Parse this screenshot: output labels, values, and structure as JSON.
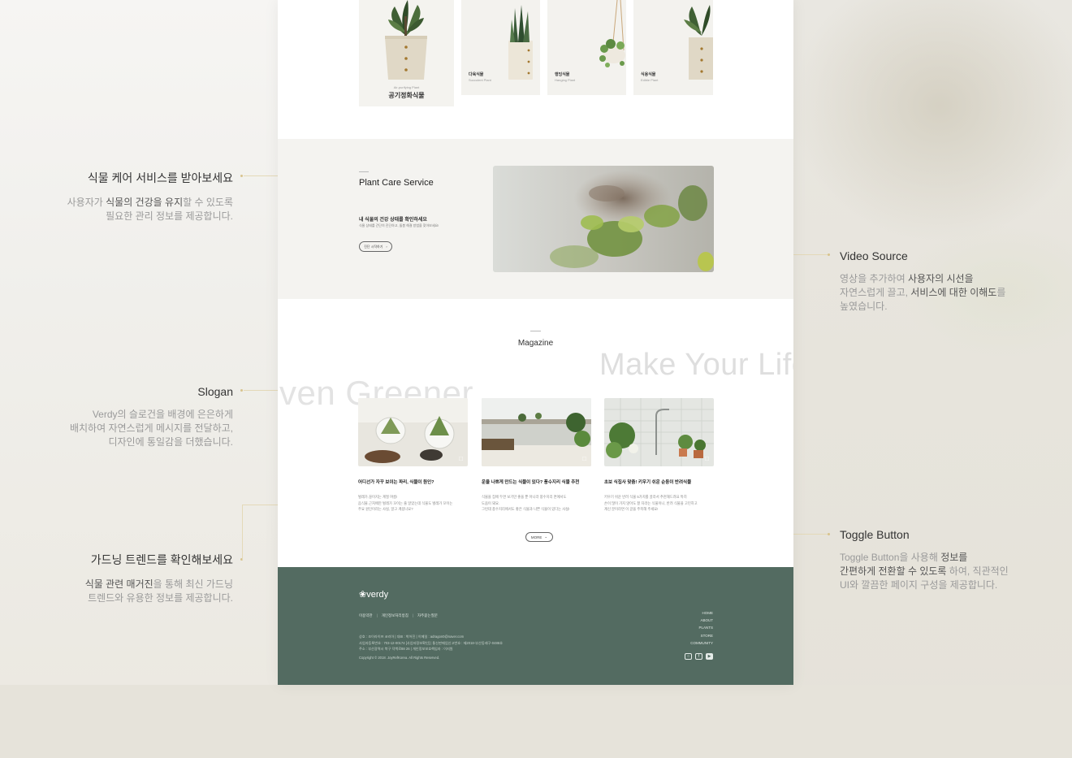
{
  "plants": {
    "big": {
      "sub": "Air-purifying Plant",
      "title": "공기정화식물"
    },
    "cards": [
      {
        "title": "다육식물",
        "sub": "Succulent Plant"
      },
      {
        "title": "행잉식물",
        "sub": "Hanging Plant"
      },
      {
        "title": "식용식물",
        "sub": "Edible Plant"
      }
    ]
  },
  "care": {
    "title": "Plant Care Service",
    "caption": "내 식물의 건강 상태를 확인하세요",
    "desc": "식물 상태를 간단히 진단하고, 돌봄 해결 방법을 찾아보세요!",
    "button": "진단 시작하기"
  },
  "magazine": {
    "title": "Magazine",
    "slogan_a": "ven Greener",
    "slogan_b": "Make Your Life",
    "items": [
      {
        "title": "어디선가 자꾸 보이는 파리, 식물이 원인?",
        "line1": "벌레가 끊이지는 계절 여름!",
        "line2": "음식물 근처에만 벌레가 꼬이는 줄 알았는데 식물도 벌레가 꼬이는",
        "line3": "주요 원인이라는 사실, 알고 계셨나요?"
      },
      {
        "title": "운을 나쁘게 만드는 식물이 있다? 풍수지리 식물 추천",
        "line1": "식물을 집에 두면 보기만 좋을 뿐 아니라 풍수지리 면에서도",
        "line2": "도움이 돼요.",
        "line3": "그런데 풍수지리에서도 좋은 식물과 나쁜 식물이 있다는 사실!"
      },
      {
        "title": "초보 식집사 맞춤! 키우기 쉬운 순둥이 반려식물",
        "line1": "키우기 쉬운 반려 식물 5가지를 골라서 추천해드려요 특히",
        "line2": "손이 많이 가지 않아도 잘 자라는 식물이니, 반려 식물을 고민하고",
        "line3": "계신 분이라면 이 글을 주목해 주세요!"
      }
    ],
    "more": "MORE"
  },
  "footer": {
    "logo": "verdy",
    "links": [
      "이용약관",
      "개인정보처리방침",
      "자주묻는질문"
    ],
    "info1": "상호 : 조이라이프 코리아 | 대표 : 박어진 | 이메일 : adragon0@naver.com",
    "info2": "사업자등록번호 : 703-12-00174 [사업자정보확인] | 통신판매업신고번호 : 제2018-부산동래구-0486호",
    "info3": "주소 : 부산광역시 북구 덕백로88 26 | 개인정보보호책임자 : 이지원",
    "copyright": "Copyright © 2018. JoyRefKorea. All Rights Reserved.",
    "nav": [
      "HOME",
      "ABOUT",
      "PLANTS",
      "STORE",
      "COMMUNITY"
    ]
  },
  "annotations": {
    "care": {
      "title": "식물 케어 서비스를 받아보세요",
      "d1a": "사용자가 ",
      "d1b": "식물의 건강을 유지",
      "d1c": "할 수 있도록",
      "d2": "필요한 관리 정보를 제공합니다."
    },
    "slogan": {
      "title": "Slogan",
      "d1": "Verdy의 슬로건을 배경에 은은하게",
      "d2": "배치하여 자연스럽게 메시지를 전달하고,",
      "d3": "디자인에 통일감을 더했습니다."
    },
    "trend": {
      "title": "가드닝 트렌드를 확인해보세요",
      "d1a": "식물 관련 매거진",
      "d1b": "을 통해 최신 가드닝",
      "d2": "트렌드와 유용한 정보를 제공합니다."
    },
    "video": {
      "title": "Video Source",
      "d1a": "영상을 추가하여 ",
      "d1b": "사용자의 시선을",
      "d2a": "자연스럽게 끌고, ",
      "d2b": "서비스에 대한 이해도",
      "d2c": "를",
      "d3": "높였습니다."
    },
    "toggle": {
      "title": "Toggle Button",
      "d1a": "Toggle Button을 사용해 ",
      "d1b": "정보를",
      "d2a": "간편하게 전환할 수 있도록",
      "d2b": " 하여, 직관적인",
      "d3": "UI와 깔끔한 페이지 구성을 제공합니다."
    }
  },
  "colors": {
    "footer_bg": "#536b61",
    "accent_line": "#e4d9b8",
    "page_bg": "#ffffff",
    "care_bg": "#f4f3f0"
  },
  "icons": [
    "chevron-right-icon",
    "chevron-down-icon",
    "bookmark-icon",
    "instagram-icon",
    "facebook-icon",
    "youtube-icon",
    "leaf-logo-icon"
  ]
}
